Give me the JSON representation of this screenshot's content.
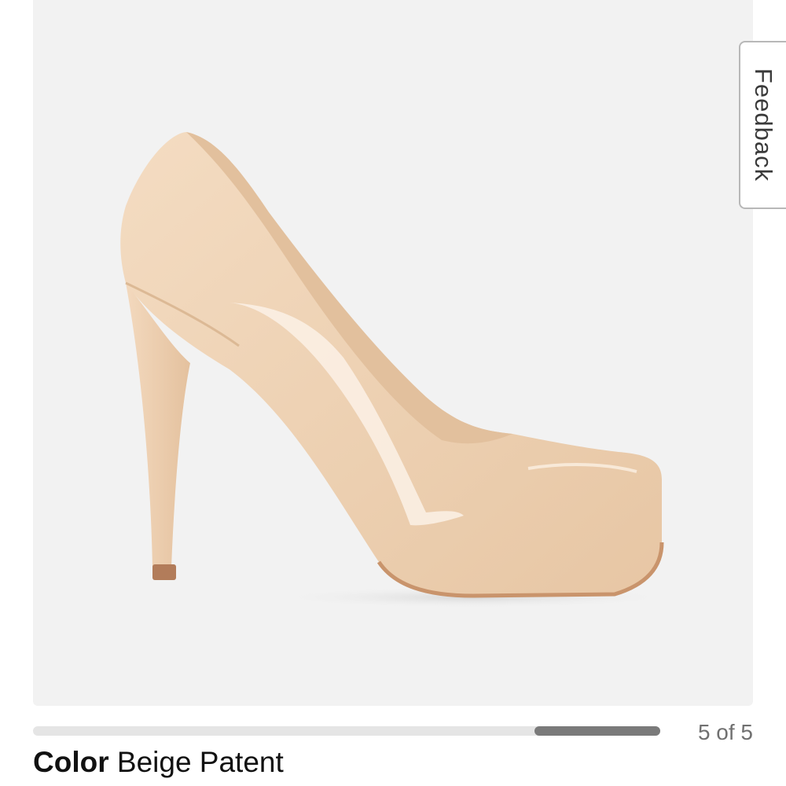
{
  "product_image": {
    "alt": "Beige patent platform pump",
    "background": "#f2f2f2",
    "shoe_color": "#efd2b4"
  },
  "feedback": {
    "label": "Feedback"
  },
  "carousel": {
    "current_slide": 5,
    "total_slides": 5,
    "counter_text": "5 of 5"
  },
  "color_selection": {
    "label": "Color",
    "value": "Beige Patent"
  }
}
